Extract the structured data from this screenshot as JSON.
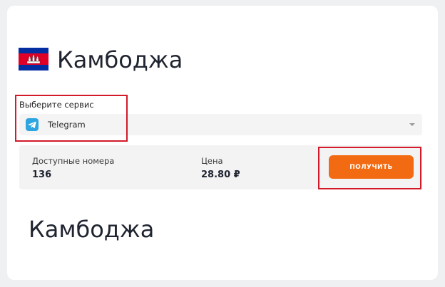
{
  "country": {
    "name": "Камбоджа",
    "flag_icon": "cambodia-flag-icon"
  },
  "service": {
    "label": "Выберите сервис",
    "selected": "Telegram",
    "icon": "telegram-icon"
  },
  "info": {
    "available_label": "Доступные номера",
    "available_value": "136",
    "price_label": "Цена",
    "price_value": "28.80 ₽"
  },
  "action": {
    "button_label": "ПОЛУЧИТЬ"
  },
  "bottom_heading": "Камбоджа",
  "colors": {
    "accent": "#f26a12",
    "highlight": "#d21a2a",
    "telegram": "#2ca5e0"
  }
}
